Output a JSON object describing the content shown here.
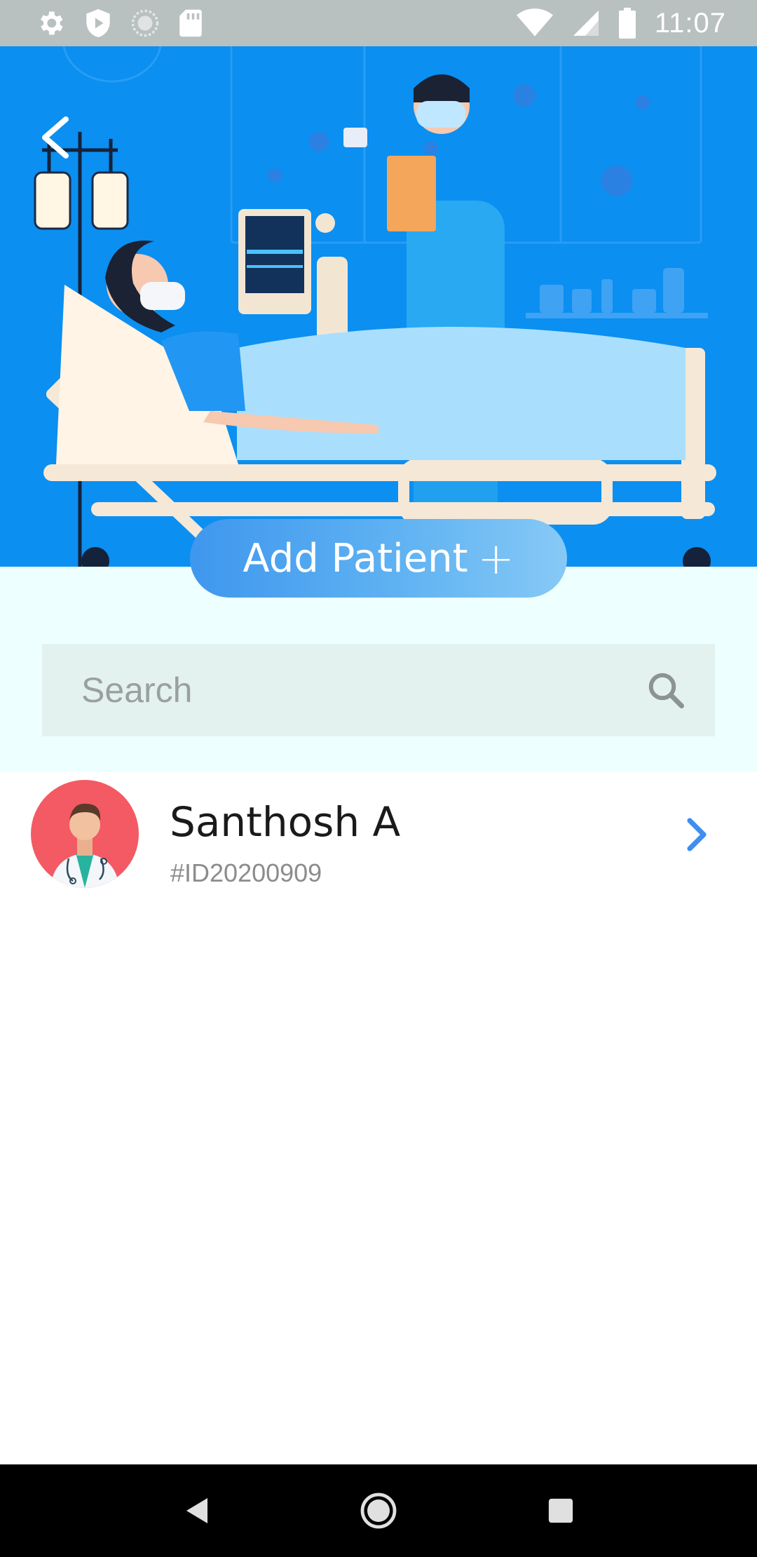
{
  "status_bar": {
    "time": "11:07",
    "left_icons": [
      "settings-icon",
      "play-protect-icon",
      "sync-icon",
      "sd-card-icon"
    ],
    "right_icons": [
      "wifi-icon",
      "cell-signal-icon",
      "battery-icon"
    ]
  },
  "hero": {
    "illustration": "hospital-patient-illustration",
    "back_icon": "back-arrow-icon"
  },
  "actions": {
    "add_patient_label": "Add Patient",
    "add_patient_icon": "+"
  },
  "search": {
    "placeholder": "Search",
    "value": ""
  },
  "patients": [
    {
      "name": "Santhosh A",
      "id": "#ID20200909",
      "avatar": "doctor-avatar-icon"
    }
  ],
  "colors": {
    "hero_bg": "#0b8ff1",
    "band_bg": "#edfffe",
    "search_bg": "#e4f2ef",
    "accent_blue": "#3f8ef0",
    "avatar_bg": "#f35a63"
  }
}
